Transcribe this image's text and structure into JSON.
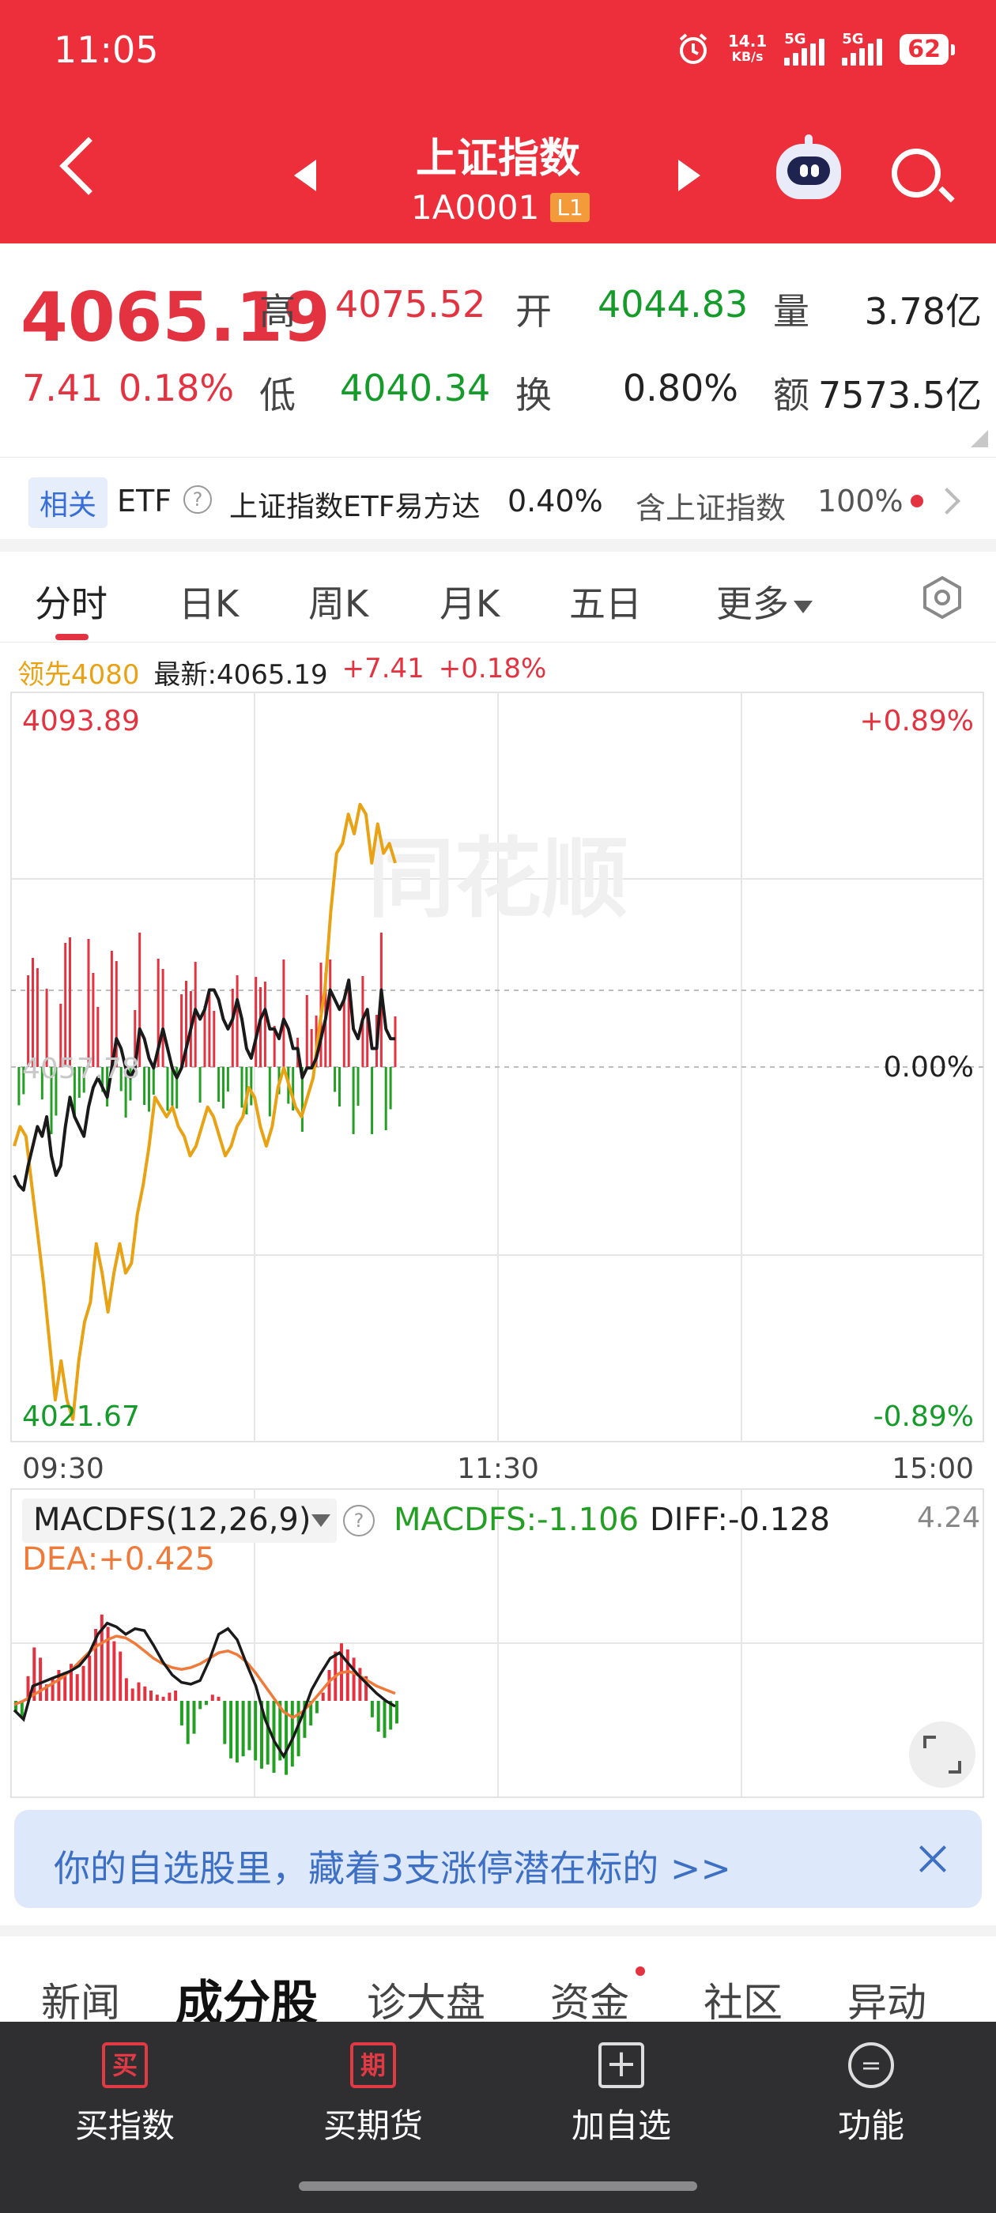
{
  "status_bar": {
    "time": "11:05",
    "net_speed_value": "14.1",
    "net_speed_unit": "KB/s",
    "signal1_label": "5G",
    "signal2_label": "5G",
    "battery": "62"
  },
  "header": {
    "title": "上证指数",
    "code": "1A0001",
    "level_badge": "L1",
    "icons": [
      "back-icon",
      "prev-triangle-icon",
      "next-triangle-icon",
      "robot-assistant-icon",
      "search-icon"
    ]
  },
  "quote": {
    "price": "4065.19",
    "change": "7.41",
    "change_pct": "0.18%",
    "high_label": "高",
    "high": "4075.52",
    "open_label": "开",
    "open": "4044.83",
    "volume_label": "量",
    "volume": "3.78亿",
    "low_label": "低",
    "low": "4040.34",
    "turnover_label": "换",
    "turnover": "0.80%",
    "amount_label": "额",
    "amount": "7573.5亿"
  },
  "etf": {
    "tag": "相关",
    "etf_label": "ETF",
    "help": "?",
    "name": "上证指数ETF易方达",
    "change": "0.40%",
    "holding_label": "含上证指数",
    "holding": "100%"
  },
  "tabs": [
    {
      "label": "分时"
    },
    {
      "label": "日K"
    },
    {
      "label": "周K"
    },
    {
      "label": "月K"
    },
    {
      "label": "五日"
    },
    {
      "label": "更多"
    }
  ],
  "chart_legend": {
    "lead": "领先4080",
    "latest": "最新:4065.19",
    "change": "+7.41",
    "change_pct": "+0.18%"
  },
  "chart_labels": {
    "y_top": "4093.89",
    "y_bottom": "4021.67",
    "pct_top": "+0.89%",
    "pct_zero": "0.00%",
    "pct_bottom": "-0.89%",
    "base_faint": "4057.78",
    "t_start": "09:30",
    "t_mid": "11:30",
    "t_end": "15:00",
    "watermark": "同花顺"
  },
  "macd": {
    "selector": "MACDFS(12,26,9)",
    "help": "?",
    "macdfs": "MACDFS:-1.106",
    "diff": "DIFF:-0.128",
    "dea": "DEA:+0.425",
    "scale_top": "4.24"
  },
  "chart_data": [
    {
      "type": "line",
      "title": "",
      "xlabel": "",
      "ylabel": "",
      "x_ticks": [
        "09:30",
        "11:30",
        "15:00"
      ],
      "ylim": [
        4021.67,
        4093.89
      ],
      "base": 4057.78,
      "series": [
        {
          "name": "最新",
          "color": "#1a1a1a",
          "values": [
            4047.0,
            4046.0,
            4045.5,
            4048,
            4050,
            4052,
            4051,
            4053,
            4049,
            4047,
            4048,
            4052,
            4055,
            4053,
            4052,
            4051,
            4054,
            4056,
            4057,
            4056,
            4055,
            4058,
            4061,
            4060,
            4058,
            4057,
            4058,
            4062,
            4061,
            4059,
            4058,
            4060,
            4062,
            4060,
            4058,
            4057,
            4058,
            4060,
            4062,
            4064,
            4063,
            4064,
            4066,
            4066,
            4065,
            4063,
            4062,
            4063,
            4065,
            4063,
            4060,
            4059,
            4061,
            4063,
            4064,
            4062,
            4062,
            4061,
            4063,
            4062,
            4060,
            4060,
            4057,
            4058,
            4058,
            4059,
            4061,
            4063,
            4066,
            4065,
            4064,
            4065,
            4067,
            4062,
            4061,
            4063,
            4064,
            4060,
            4060,
            4066,
            4062,
            4061,
            4061
          ]
        },
        {
          "name": "领先",
          "color": "#e8a214",
          "values": [
            4050,
            4052,
            4051,
            4046,
            4041,
            4036,
            4030,
            4024,
            4028,
            4024,
            4022,
            4028,
            4032,
            4034,
            4040,
            4037,
            4033,
            4037,
            4040,
            4037,
            4038,
            4043,
            4046,
            4050,
            4055,
            4054,
            4053,
            4054,
            4052,
            4051,
            4049,
            4050,
            4052,
            4054,
            4053,
            4051,
            4049,
            4050,
            4052,
            4053,
            4056,
            4055,
            4052,
            4050,
            4052,
            4056,
            4058,
            4056,
            4054,
            4053,
            4055,
            4057,
            4062,
            4066,
            4074,
            4080,
            4081,
            4084,
            4082,
            4085,
            4084,
            4079,
            4083,
            4080,
            4081,
            4079
          ]
        }
      ]
    },
    {
      "type": "bar",
      "title": "",
      "series": [
        {
          "name": "MACDFS",
          "values": [
            -0.5,
            -0.8,
            1.2,
            2.6,
            2.1,
            0.8,
            1.1,
            1.5,
            1.4,
            1.8,
            1.3,
            1.7,
            2.2,
            3.5,
            4.2,
            3.6,
            2.9,
            2.4,
            1.1,
            0.6,
            0.9,
            0.7,
            0.5,
            0.3,
            0.2,
            0.4,
            0.5,
            -1.2,
            -2.1,
            -1.6,
            -0.4,
            -0.2,
            0.3,
            0.2,
            -2.1,
            -2.8,
            -3.0,
            -2.7,
            -2.4,
            -2.9,
            -3.3,
            -3.1,
            -3.5,
            -2.9,
            -3.6,
            -3.2,
            -2.7,
            -1.8,
            -1.2,
            -0.6,
            0.4,
            1.5,
            2.4,
            2.8,
            2.5,
            2.1,
            1.6,
            1.2,
            -0.8,
            -1.5,
            -1.8,
            -1.4,
            -1.1
          ]
        },
        {
          "name": "DIFF",
          "values": [
            -0.5,
            -1.0,
            0.8,
            1.0,
            1.2,
            1.4,
            1.6,
            1.9,
            2.5,
            3.6,
            4.2,
            4.0,
            3.6,
            3.9,
            3.8,
            3.0,
            2.1,
            1.4,
            1.0,
            0.9,
            1.1,
            2.2,
            3.6,
            3.9,
            3.3,
            2.0,
            0.8,
            -1.0,
            -2.2,
            -3.0,
            -2.0,
            -0.8,
            0.6,
            1.5,
            2.3,
            2.6,
            2.0,
            1.4,
            0.9,
            0.4,
            0.0,
            -0.3
          ]
        },
        {
          "name": "DEA",
          "values": [
            -0.2,
            0.0,
            0.3,
            0.6,
            0.9,
            1.2,
            1.6,
            2.1,
            2.6,
            3.0,
            3.3,
            3.5,
            3.4,
            3.1,
            2.7,
            2.3,
            2.0,
            1.8,
            1.7,
            1.8,
            2.0,
            2.3,
            2.6,
            2.7,
            2.5,
            2.1,
            1.5,
            0.8,
            0.1,
            -0.6,
            -0.9,
            -0.6,
            -0.1,
            0.5,
            1.1,
            1.5,
            1.6,
            1.4,
            1.1,
            0.8,
            0.6,
            0.4
          ]
        }
      ],
      "colors": {
        "up": "#e43340",
        "down": "#23a023",
        "diff": "#1a1a1a",
        "dea": "#f07a3a"
      }
    }
  ],
  "banner": {
    "text": "你的自选股里，藏着3支涨停潜在标的 >>"
  },
  "bottom_tabs": [
    {
      "label": "新闻"
    },
    {
      "label": "成分股"
    },
    {
      "label": "诊大盘"
    },
    {
      "label": "资金"
    },
    {
      "label": "社区"
    },
    {
      "label": "异动"
    }
  ],
  "bottom_nav": [
    {
      "icon_text": "买",
      "label": "买指数"
    },
    {
      "icon_text": "期",
      "label": "买期货"
    },
    {
      "icon_text": "+",
      "label": "加自选"
    },
    {
      "icon_text": "=",
      "label": "功能"
    }
  ],
  "colors": {
    "brand_red": "#ec2f3b",
    "up": "#e43340",
    "down": "#149b2a",
    "lead_line": "#e8a214",
    "banner_text": "#3d6fc4"
  }
}
